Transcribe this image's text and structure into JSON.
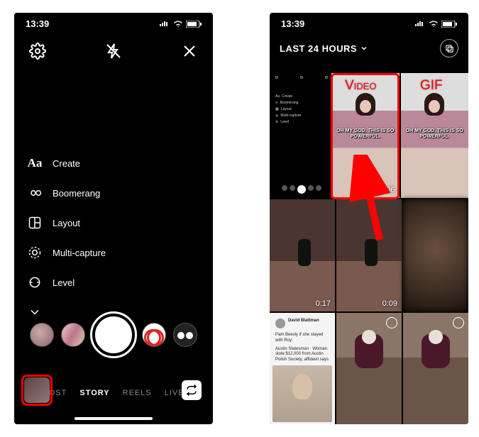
{
  "status": {
    "time": "13:39"
  },
  "left": {
    "menu": {
      "create": "Create",
      "boomerang": "Boomerang",
      "layout": "Layout",
      "multicapture": "Multi-capture",
      "level": "Level"
    },
    "modes": {
      "post": "POST",
      "story": "STORY",
      "reels": "REELS",
      "live": "LIVE"
    }
  },
  "right": {
    "picker_title": "LAST 24 HOURS",
    "mini_menu": {
      "create": "Create",
      "boomerang": "Boomerang",
      "layout": "Layout",
      "multicapture": "Multi-capture",
      "level": "Level"
    },
    "tiles": {
      "caption1": "OH MY GOD. THIS IS SO POWERFUL.",
      "caption2": "OH MY GOD. THIS IS SO POWERFUL.",
      "dur1": "0:06",
      "dur2": "0:17",
      "dur3": "0:09",
      "tweet_name": "David Blattman",
      "tweet_q": "Pam Beesly if she stayed with Roy:",
      "tweet_body": "Austin Statesman · Woman stole $12,000 from Austin Polish Society, affidavit says"
    }
  },
  "annotations": {
    "video": "Video",
    "gif": "GIF"
  }
}
